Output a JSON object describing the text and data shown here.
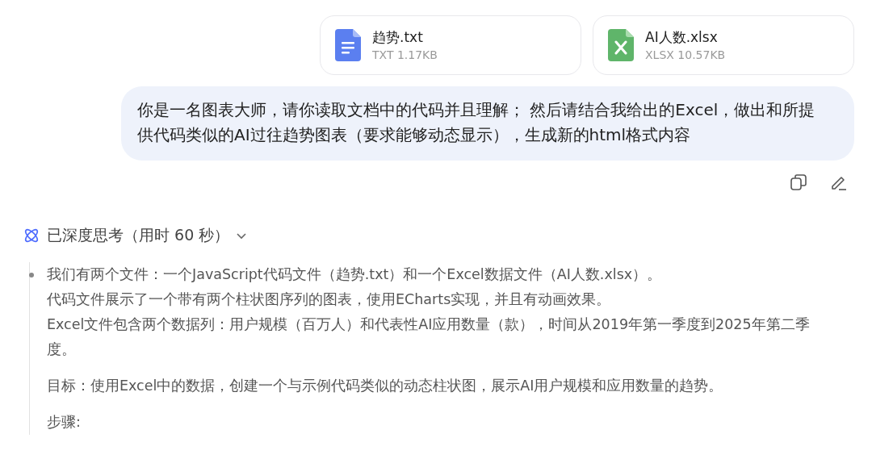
{
  "attachments": [
    {
      "kind": "doc",
      "name": "趋势.txt",
      "meta": "TXT 1.17KB"
    },
    {
      "kind": "sheet",
      "name": "AI人数.xlsx",
      "meta": "XLSX 10.57KB"
    }
  ],
  "message": {
    "text": "你是一名图表大师，请你读取文档中的代码并且理解； 然后请结合我给出的Excel，做出和所提供代码类似的AI过往趋势图表（要求能够动态显示），生成新的html格式内容"
  },
  "thinking": {
    "header": "已深度思考（用时 60 秒）",
    "expanded": true,
    "paragraphs": [
      {
        "text": "我们有两个文件：一个JavaScript代码文件（趋势.txt）和一个Excel数据文件（AI人数.xlsx）。",
        "bullet": true,
        "gap": false
      },
      {
        "text": "代码文件展示了一个带有两个柱状图序列的图表，使用ECharts实现，并且有动画效果。",
        "bullet": false,
        "gap": false
      },
      {
        "text": "Excel文件包含两个数据列：用户规模（百万人）和代表性AI应用数量（款），时间从2019年第一季度到2025年第二季度。",
        "bullet": false,
        "gap": false
      },
      {
        "text": "目标：使用Excel中的数据，创建一个与示例代码类似的动态柱状图，展示AI用户规模和应用数量的趋势。",
        "bullet": false,
        "gap": true
      },
      {
        "text": "步骤:",
        "bullet": false,
        "gap": true
      }
    ]
  }
}
